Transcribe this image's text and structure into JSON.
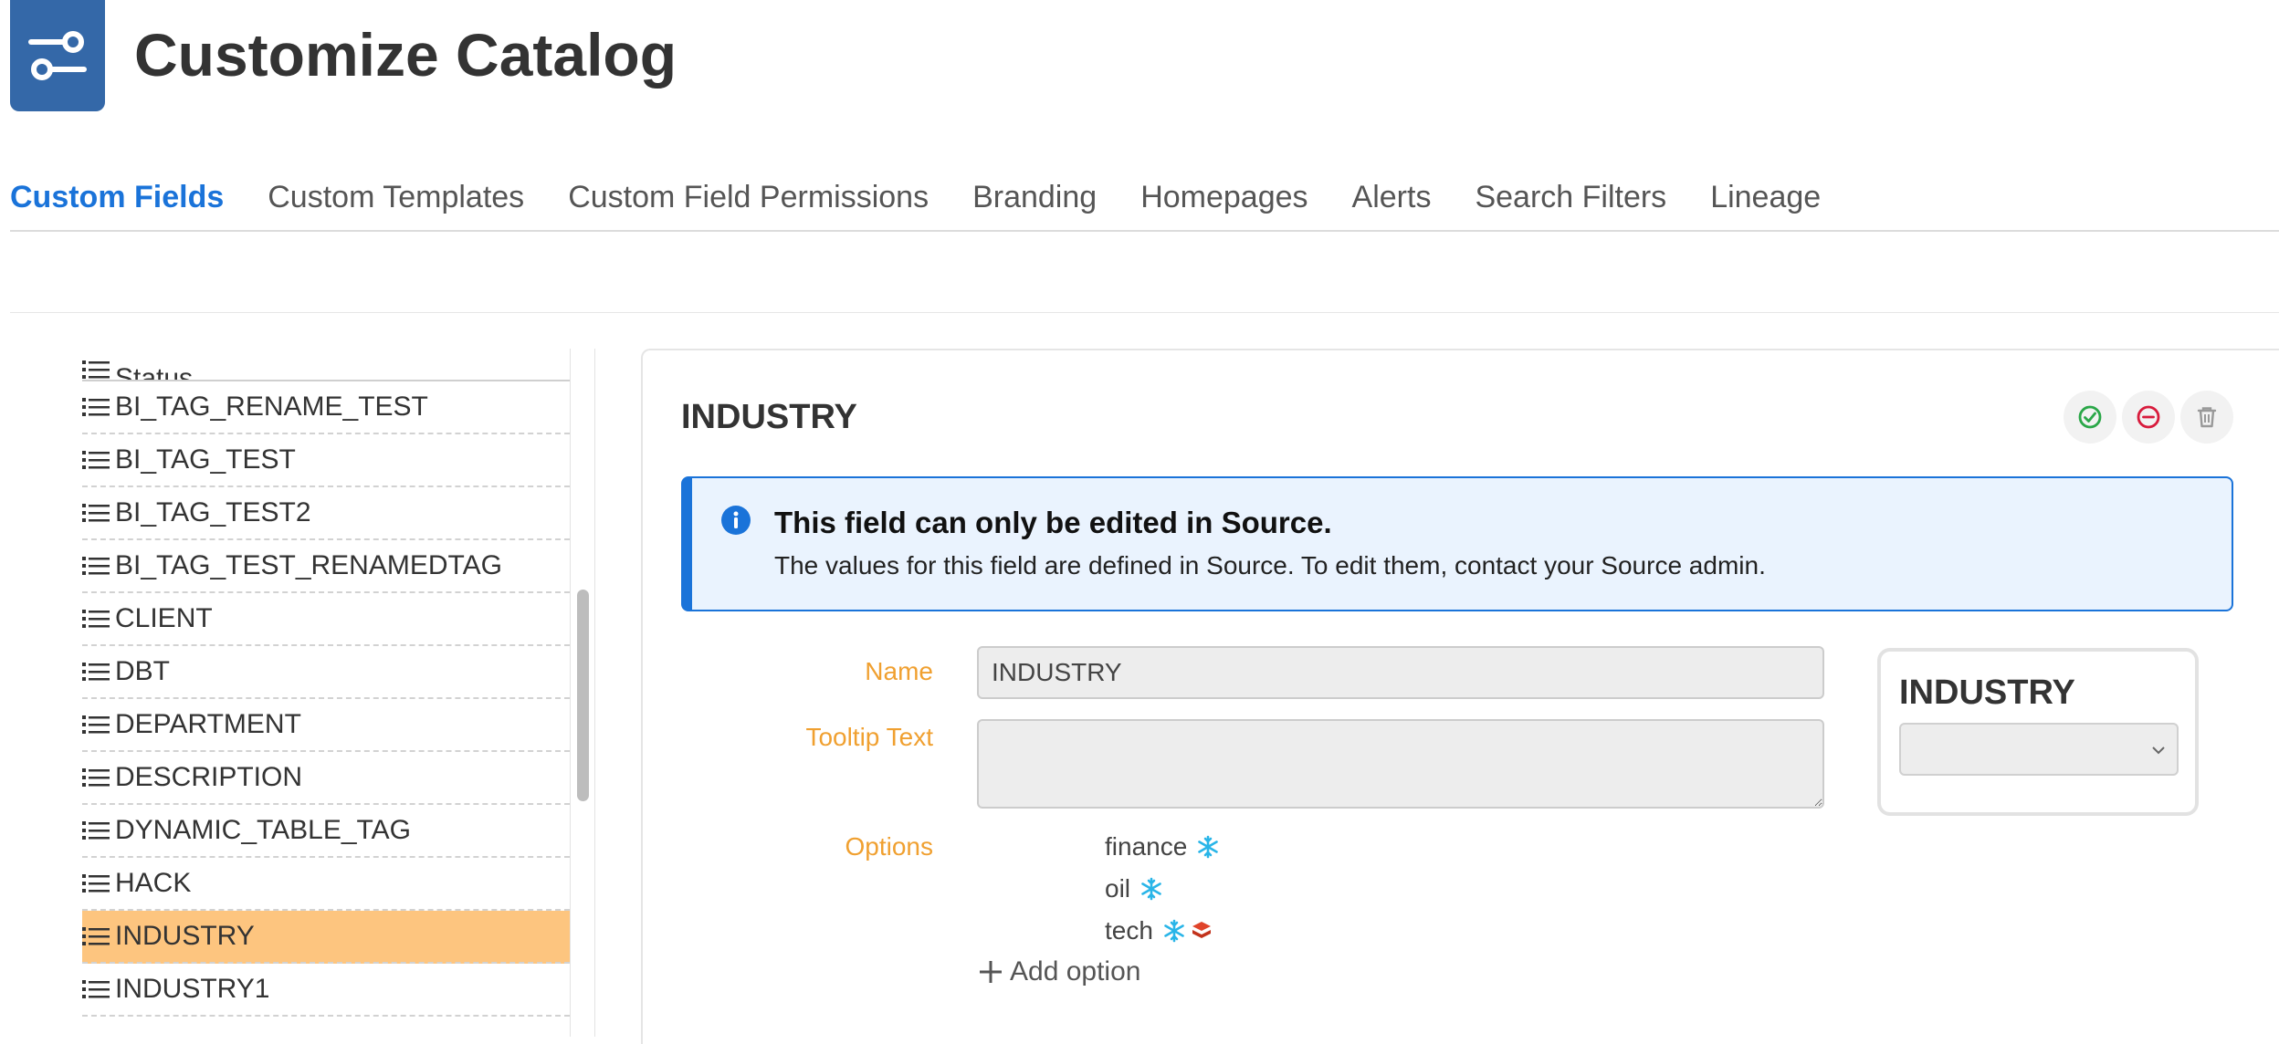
{
  "header": {
    "title": "Customize Catalog",
    "logo_icon": "sliders-icon"
  },
  "tabs": [
    {
      "label": "Custom Fields",
      "active": true
    },
    {
      "label": "Custom Templates"
    },
    {
      "label": "Custom Field Permissions"
    },
    {
      "label": "Branding"
    },
    {
      "label": "Homepages"
    },
    {
      "label": "Alerts"
    },
    {
      "label": "Search Filters"
    },
    {
      "label": "Lineage"
    }
  ],
  "sidebar": {
    "items": [
      {
        "label": "Status"
      },
      {
        "label": "BI_TAG_RENAME_TEST"
      },
      {
        "label": "BI_TAG_TEST"
      },
      {
        "label": "BI_TAG_TEST2"
      },
      {
        "label": "BI_TAG_TEST_RENAMEDTAG"
      },
      {
        "label": "CLIENT"
      },
      {
        "label": "DBT"
      },
      {
        "label": "DEPARTMENT"
      },
      {
        "label": "DESCRIPTION"
      },
      {
        "label": "DYNAMIC_TABLE_TAG"
      },
      {
        "label": "HACK"
      },
      {
        "label": "INDUSTRY",
        "selected": true
      },
      {
        "label": "INDUSTRY1"
      }
    ]
  },
  "detail": {
    "title": "INDUSTRY",
    "actions": [
      "check-circle-icon",
      "minus-circle-icon",
      "trash-icon"
    ],
    "info": {
      "title": "This field can only be edited in Source.",
      "text": "The values for this field are defined in Source. To edit them, contact your Source admin."
    },
    "form": {
      "name_label": "Name",
      "name_value": "INDUSTRY",
      "tooltip_label": "Tooltip Text",
      "tooltip_value": "",
      "options_label": "Options",
      "options": [
        {
          "label": "finance",
          "icons": [
            "snowflake-icon"
          ]
        },
        {
          "label": "oil",
          "icons": [
            "snowflake-icon"
          ]
        },
        {
          "label": "tech",
          "icons": [
            "snowflake-icon",
            "layers-icon"
          ]
        }
      ],
      "add_option_label": "Add option"
    },
    "preview": {
      "title": "INDUSTRY",
      "select_value": ""
    }
  },
  "colors": {
    "accent": "#1a73d9",
    "logo": "#3468a8",
    "label": "#f0a030",
    "selected_row": "#fdc57f",
    "snowflake": "#29b5e8",
    "layers": "#e0442a"
  }
}
